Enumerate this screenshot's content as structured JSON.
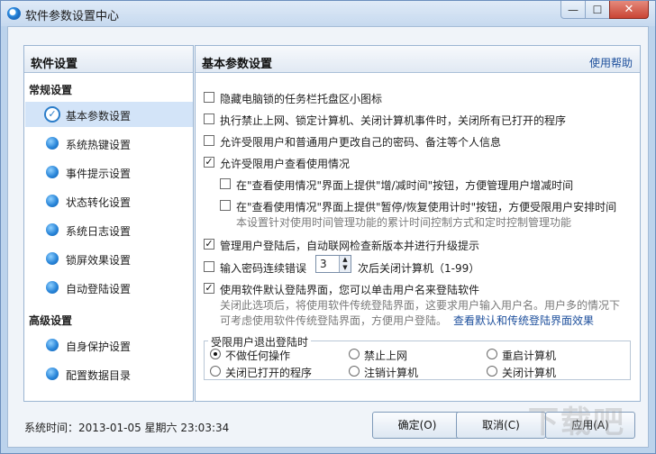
{
  "window": {
    "title": "软件参数设置中心",
    "min_icon": "—",
    "max_icon": "☐",
    "close_icon": "✕"
  },
  "sidebar": {
    "title": "软件设置",
    "groups": [
      "常规设置",
      "高级设置"
    ],
    "items": [
      {
        "label": "基本参数设置",
        "selected": true
      },
      {
        "label": "系统热键设置"
      },
      {
        "label": "事件提示设置"
      },
      {
        "label": "状态转化设置"
      },
      {
        "label": "系统日志设置"
      },
      {
        "label": "锁屏效果设置"
      },
      {
        "label": "自动登陆设置"
      },
      {
        "label": "自身保护设置"
      },
      {
        "label": "配置数据目录"
      }
    ]
  },
  "content": {
    "title": "基本参数设置",
    "help": "使用帮助",
    "options": [
      {
        "label": "隐藏电脑锁的任务栏托盘区小图标",
        "checked": false
      },
      {
        "label": "执行禁止上网、锁定计算机、关闭计算机事件时，关闭所有已打开的程序",
        "checked": false
      },
      {
        "label": "允许受限用户和普通用户更改自己的密码、备注等个人信息",
        "checked": false
      },
      {
        "label": "允许受限用户查看使用情况",
        "checked": true
      },
      {
        "label": "在\"查看使用情况\"界面上提供\"增/减时间\"按钮，方便管理用户增减时间",
        "checked": false
      },
      {
        "label": "在\"查看使用情况\"界面上提供\"暂停/恢复使用计时\"按钮，方便受限用户安排时间",
        "checked": false
      },
      {
        "label": "管理用户登陆后，自动联网检查新版本并进行升级提示",
        "checked": true
      },
      {
        "label": "输入密码连续错误",
        "checked": false
      },
      {
        "label": "使用软件默认登陆界面，您可以单击用户名来登陆软件",
        "checked": true
      }
    ],
    "note_timer": "本设置针对使用时间管理功能的累计时间控制方式和定时控制管理功能",
    "password_count": "3",
    "password_suffix": "次后关闭计算机（1-99）",
    "note_login_1": "关闭此选项后，将使用软件传统登陆界面，这要求用户输入用户名。用户多的情况下",
    "note_login_2": "可考虑使用软件传统登陆界面，方便用户登陆。",
    "compare_link": "查看默认和传统登陆界面效果",
    "logout_group": {
      "title": "受限用户退出登陆时",
      "options": [
        {
          "label": "不做任何操作",
          "selected": true
        },
        {
          "label": "禁止上网",
          "selected": false
        },
        {
          "label": "重启计算机",
          "selected": false
        },
        {
          "label": "关闭已打开的程序",
          "selected": false
        },
        {
          "label": "注销计算机",
          "selected": false
        },
        {
          "label": "关闭计算机",
          "selected": false
        }
      ]
    }
  },
  "footer": {
    "system_time": "系统时间：2013-01-05  星期六  23:03:34",
    "ok": "确定(O)",
    "cancel": "取消(C)",
    "apply": "应用(A)"
  },
  "watermark": "下载吧",
  "icons": {
    "sidebar_bullet": "blue-orb-icon",
    "selected_marker": "check-circle-icon",
    "app": "lock-app-icon"
  }
}
